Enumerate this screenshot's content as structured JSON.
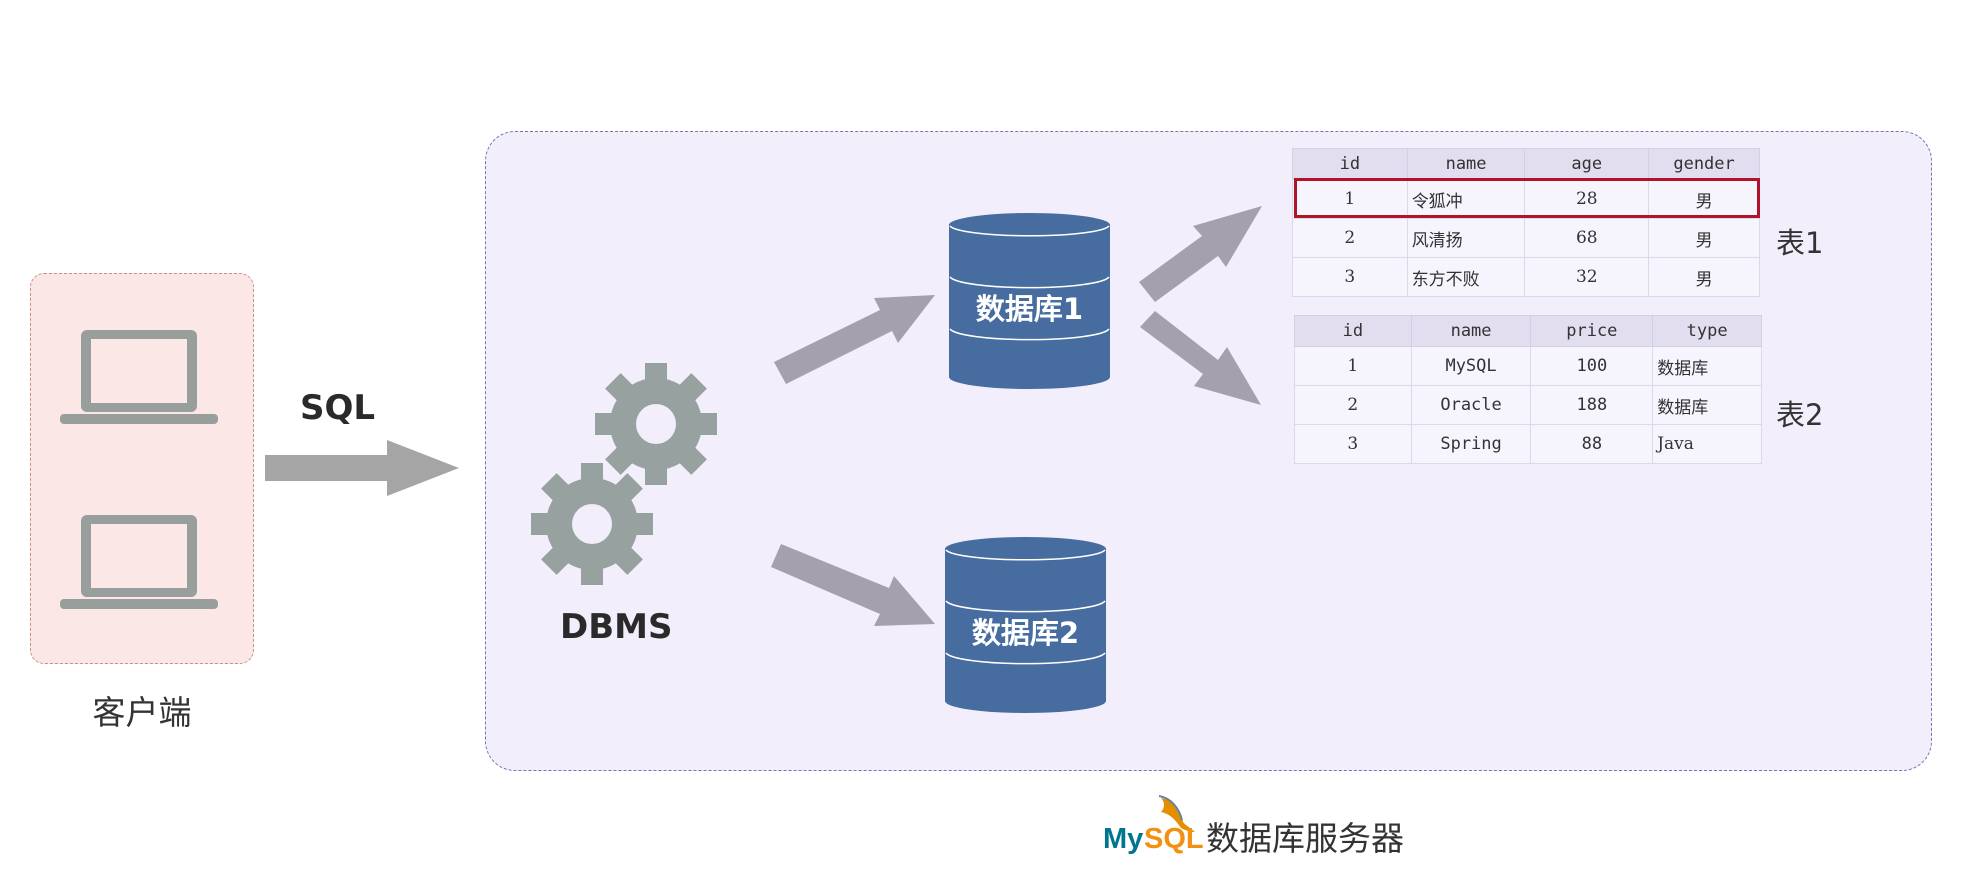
{
  "client": {
    "label": "客户端"
  },
  "arrow_label": "SQL",
  "dbms_label": "DBMS",
  "databases": [
    {
      "label": "数据库1"
    },
    {
      "label": "数据库2"
    }
  ],
  "table1": {
    "caption": "表1",
    "columns": [
      "id",
      "name",
      "age",
      "gender"
    ],
    "rows": [
      [
        "1",
        "令狐冲",
        "28",
        "男"
      ],
      [
        "2",
        "风清扬",
        "68",
        "男"
      ],
      [
        "3",
        "东方不败",
        "32",
        "男"
      ]
    ]
  },
  "table2": {
    "caption": "表2",
    "columns": [
      "id",
      "name",
      "price",
      "type"
    ],
    "rows": [
      [
        "1",
        "MySQL",
        "100",
        "数据库"
      ],
      [
        "2",
        "Oracle",
        "188",
        "数据库"
      ],
      [
        "3",
        "Spring",
        "88",
        "Java"
      ]
    ]
  },
  "footer": {
    "logo_text": "MySQL",
    "title": "数据库服务器"
  },
  "colors": {
    "db_blue": "#476c9f",
    "arrow_gray": "#a4a0ad",
    "gear_gray": "#97a19f",
    "highlight_red": "#b0142a"
  }
}
